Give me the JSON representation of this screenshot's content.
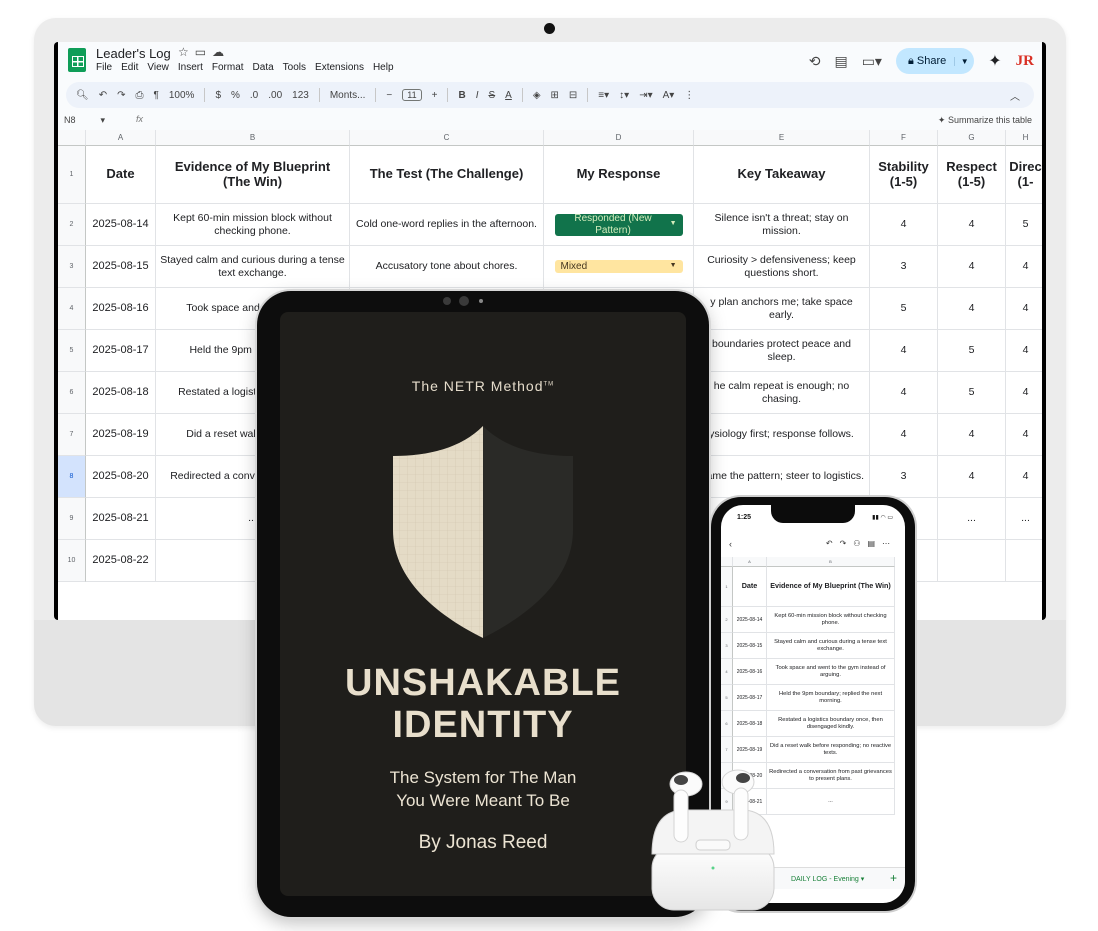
{
  "sheet": {
    "title": "Leader's Log",
    "menu": [
      "File",
      "Edit",
      "View",
      "Insert",
      "Format",
      "Data",
      "Tools",
      "Extensions",
      "Help"
    ],
    "share_label": "Share",
    "avatar_initials": "JR",
    "toolbar": {
      "zoom": "100%",
      "currency": "$",
      "percent": "%",
      "dec_decrease": ".0",
      "dec_increase": ".00",
      "number_format": "123",
      "font": "Monts...",
      "font_size": "11"
    },
    "cell_ref": "N8",
    "fx": "fx",
    "summarize_label": "Summarize this table",
    "columns": [
      "A",
      "B",
      "C",
      "D",
      "E",
      "F",
      "G",
      "H"
    ],
    "headers": [
      "Date",
      "Evidence of My Blueprint (The Win)",
      "The Test (The Challenge)",
      "My Response",
      "Key Takeaway",
      "Stability (1-5)",
      "Respect (1-5)",
      "Direc (1-"
    ],
    "row_numbers": [
      "1",
      "2",
      "3",
      "4",
      "5",
      "6",
      "7",
      "8",
      "9",
      "10"
    ],
    "rows": [
      {
        "date": "2025-08-14",
        "win": "Kept 60-min mission block without checking phone.",
        "test": "Cold one-word replies in the afternoon.",
        "response": "Responded (New Pattern)",
        "takeaway": "Silence isn't a threat; stay on mission.",
        "stability": "4",
        "respect": "4",
        "dir": "5"
      },
      {
        "date": "2025-08-15",
        "win": "Stayed calm and curious during a tense text exchange.",
        "test": "Accusatory tone about chores.",
        "response": "Mixed",
        "takeaway": "Curiosity > defensiveness; keep questions short.",
        "stability": "3",
        "respect": "4",
        "dir": "4"
      },
      {
        "date": "2025-08-16",
        "win": "Took space and w instead of",
        "test": "",
        "response": "",
        "takeaway": "y plan anchors me; take space early.",
        "stability": "5",
        "respect": "4",
        "dir": "4"
      },
      {
        "date": "2025-08-17",
        "win": "Held the 9pm bour next mc",
        "test": "",
        "response": "",
        "takeaway": "boundaries protect peace and sleep.",
        "stability": "4",
        "respect": "5",
        "dir": "4"
      },
      {
        "date": "2025-08-18",
        "win": "Restated a logistic then disenga",
        "test": "",
        "response": "",
        "takeaway": "he calm repeat is enough; no chasing.",
        "stability": "4",
        "respect": "5",
        "dir": "4"
      },
      {
        "date": "2025-08-19",
        "win": "Did a reset walk be no reacti",
        "test": "",
        "response": "",
        "takeaway": "ysiology first; response follows.",
        "stability": "4",
        "respect": "4",
        "dir": "4"
      },
      {
        "date": "2025-08-20",
        "win": "Redirected a conve grievances to p",
        "test": "",
        "response": "",
        "takeaway": "Name the pattern; steer to logistics.",
        "stability": "3",
        "respect": "4",
        "dir": "4"
      },
      {
        "date": "2025-08-21",
        "win": "...",
        "test": "",
        "response": "",
        "takeaway": "",
        "stability": "",
        "respect": "...",
        "dir": "..."
      },
      {
        "date": "2025-08-22",
        "win": "",
        "test": "",
        "response": "",
        "takeaway": "",
        "stability": "",
        "respect": "",
        "dir": ""
      }
    ]
  },
  "book": {
    "method": "The NETR Method",
    "tm": "TM",
    "title_line1": "UNSHAKABLE",
    "title_line2": "IDENTITY",
    "subtitle_line1": "The System for The Man",
    "subtitle_line2": "You Were Meant To Be",
    "author": "By Jonas Reed",
    "colors": {
      "bg": "#1f1e1b",
      "cream": "#e8dfcc"
    }
  },
  "phone": {
    "time": "1:25",
    "columns": [
      "A",
      "B"
    ],
    "header_date": "Date",
    "header_win": "Evidence of My Blueprint (The Win)",
    "rows": [
      {
        "num": "2",
        "date": "2025-08-14",
        "win": "Kept 60-min mission block without checking phone."
      },
      {
        "num": "3",
        "date": "2025-08-15",
        "win": "Stayed calm and curious during a tense text exchange."
      },
      {
        "num": "4",
        "date": "2025-08-16",
        "win": "Took space and went to the gym instead of arguing."
      },
      {
        "num": "5",
        "date": "2025-08-17",
        "win": "Held the 9pm boundary; replied the next morning."
      },
      {
        "num": "6",
        "date": "2025-08-18",
        "win": "Restated a logistics boundary once, then disengaged kindly."
      },
      {
        "num": "7",
        "date": "2025-08-19",
        "win": "Did a reset walk before responding; no reactive texts."
      },
      {
        "num": "8",
        "date": "2025-08-20",
        "win": "Redirected a conversation from past grievances to present plans."
      },
      {
        "num": "9",
        "date": "2025-08-21",
        "win": "..."
      }
    ],
    "tab_label": "DAILY LOG - Evening"
  }
}
